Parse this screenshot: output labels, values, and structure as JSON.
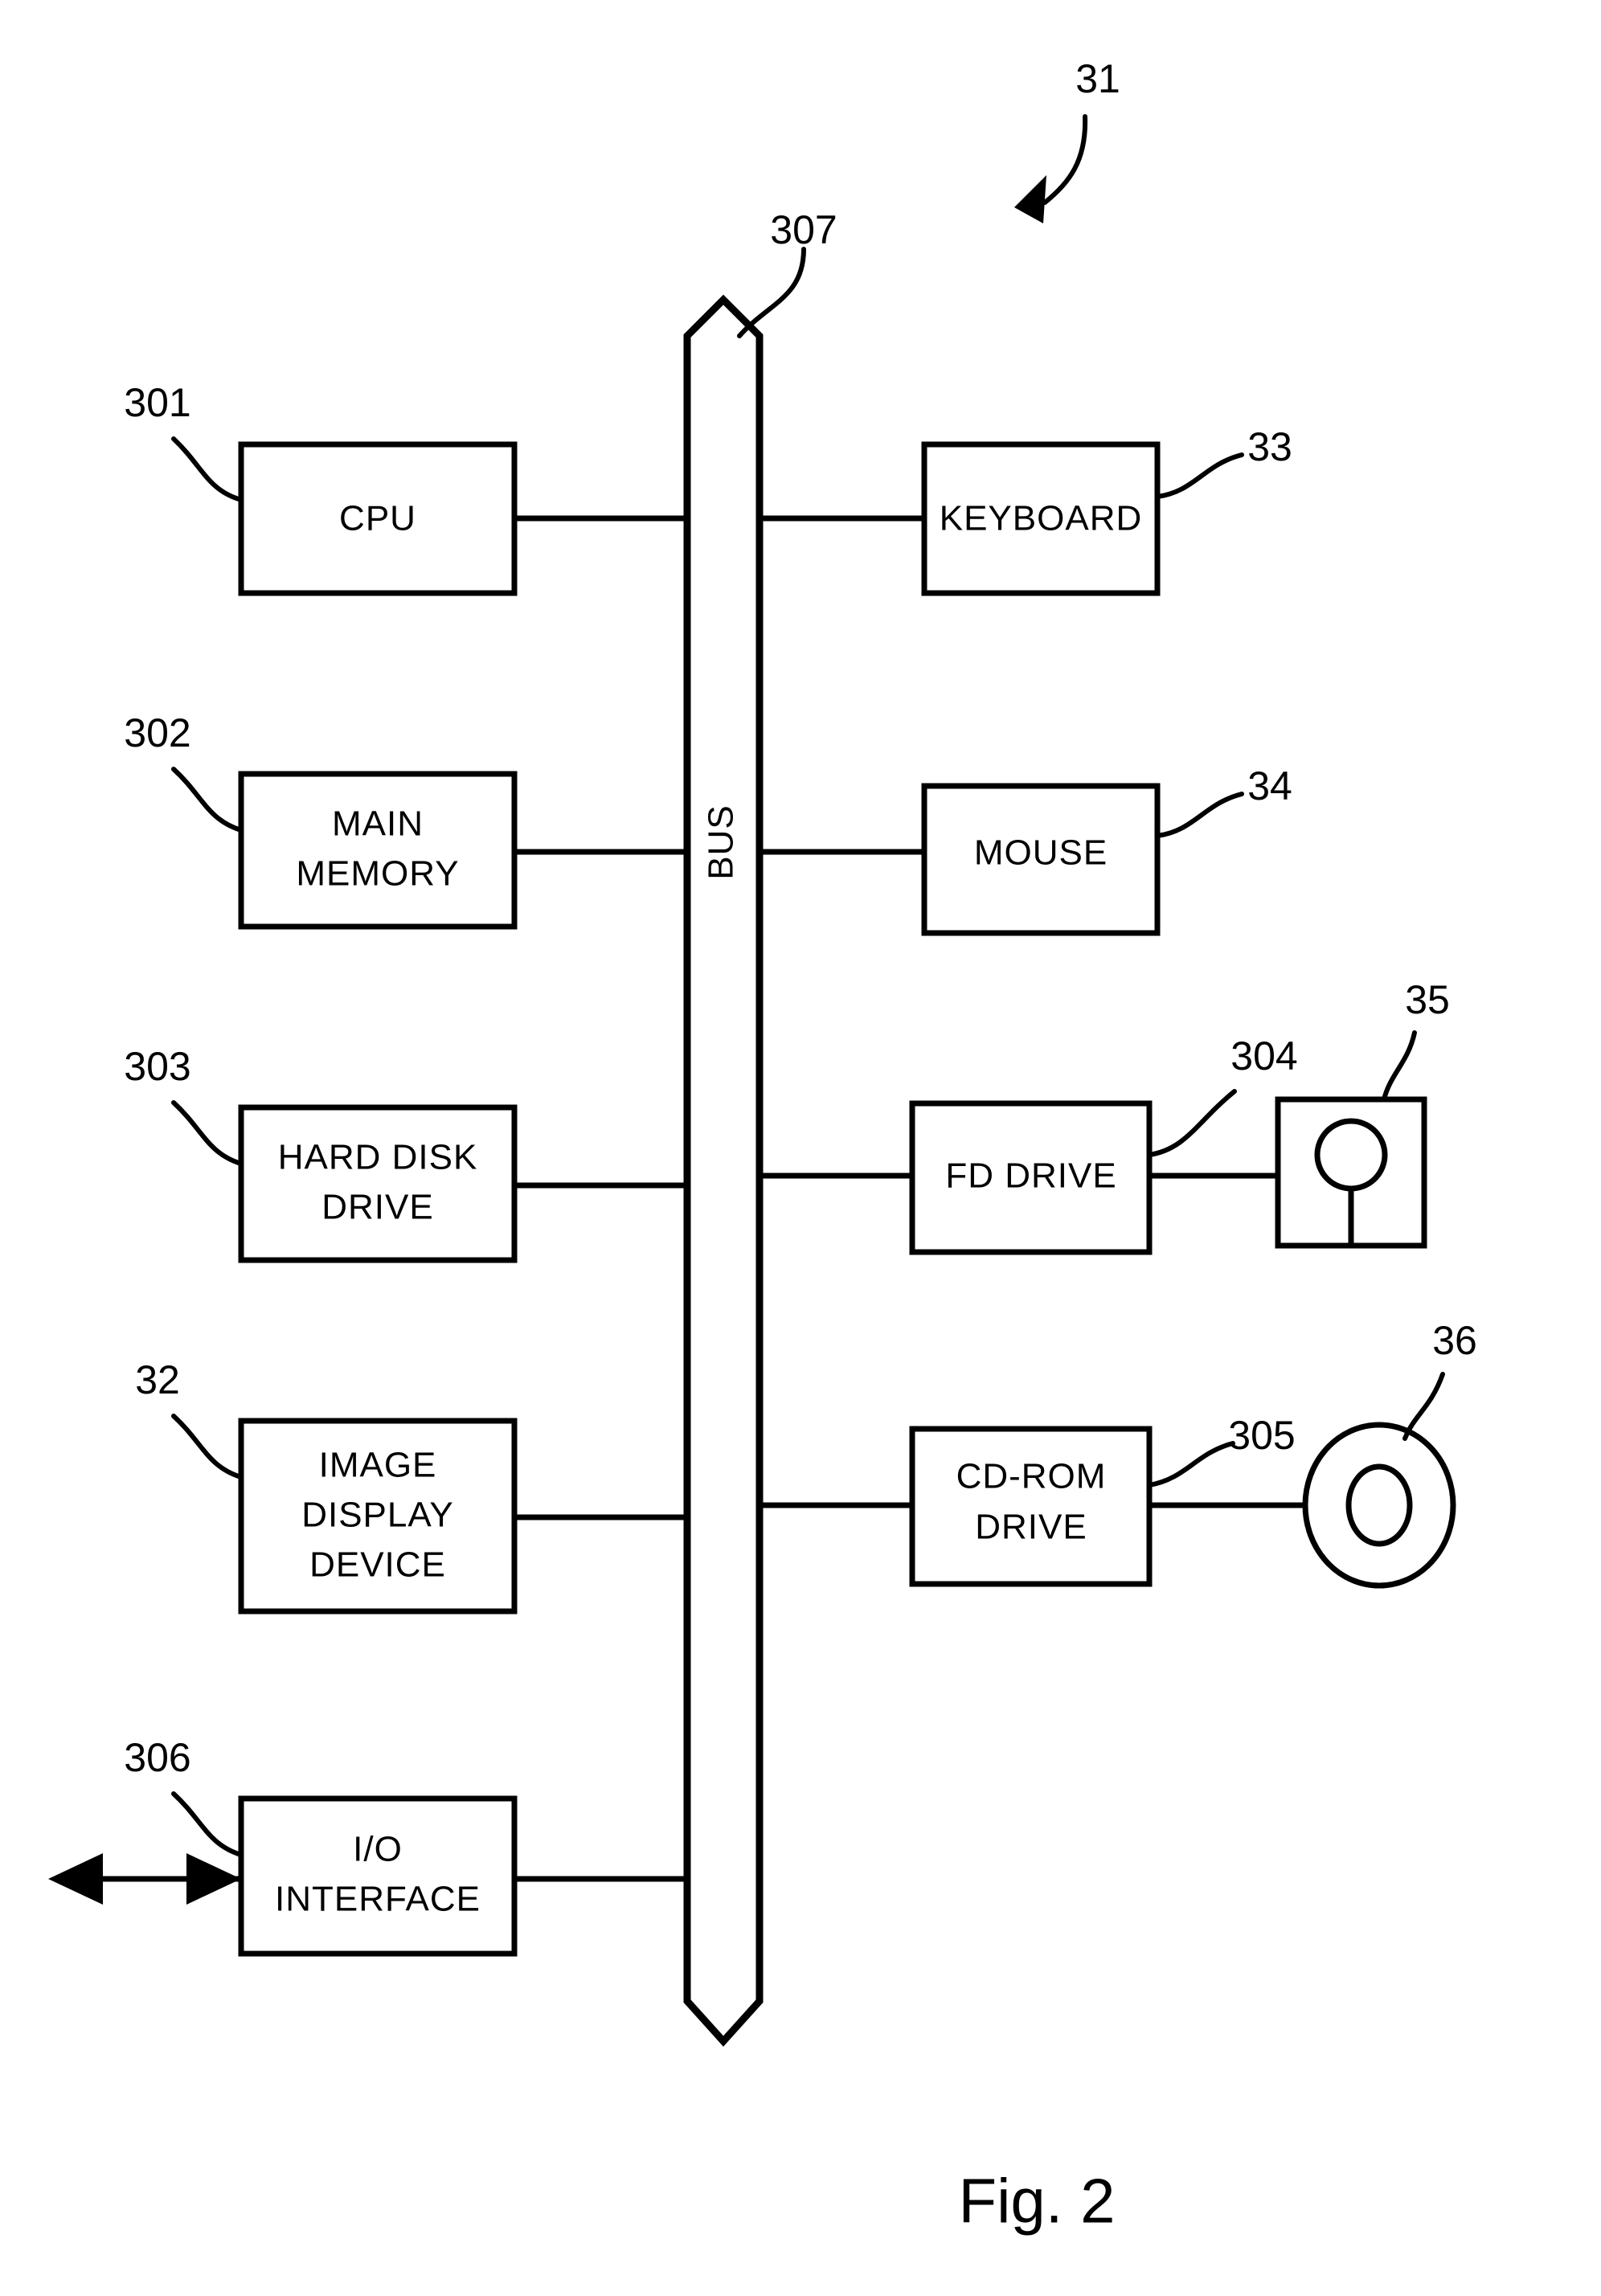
{
  "figure": {
    "caption": "Fig. 2",
    "system_ref": "31",
    "bus": {
      "label": "BUS",
      "ref": "307"
    }
  },
  "left_column": [
    {
      "id": "cpu",
      "lines": [
        "CPU"
      ],
      "ref": "301"
    },
    {
      "id": "main-memory",
      "lines": [
        "MAIN",
        "MEMORY"
      ],
      "ref": "302"
    },
    {
      "id": "hard-disk-drive",
      "lines": [
        "HARD DISK",
        "DRIVE"
      ],
      "ref": "303"
    },
    {
      "id": "image-display-device",
      "lines": [
        "IMAGE",
        "DISPLAY",
        "DEVICE"
      ],
      "ref": "32"
    },
    {
      "id": "io-interface",
      "lines": [
        "I/O",
        "INTERFACE"
      ],
      "ref": "306"
    }
  ],
  "right_column": [
    {
      "id": "keyboard",
      "lines": [
        "KEYBOARD"
      ],
      "ref": "33"
    },
    {
      "id": "mouse",
      "lines": [
        "MOUSE"
      ],
      "ref": "34"
    },
    {
      "id": "fd-drive",
      "lines": [
        "FD DRIVE"
      ],
      "ref": "304"
    },
    {
      "id": "cd-rom-drive",
      "lines": [
        "CD-ROM",
        "DRIVE"
      ],
      "ref": "305"
    }
  ],
  "media": [
    {
      "id": "floppy-disk",
      "icon": "floppy-disk-icon",
      "ref": "35"
    },
    {
      "id": "cd-rom-disc",
      "icon": "cd-disc-icon",
      "ref": "36"
    }
  ],
  "colors": {
    "ink": "#000000",
    "paper": "#ffffff"
  }
}
